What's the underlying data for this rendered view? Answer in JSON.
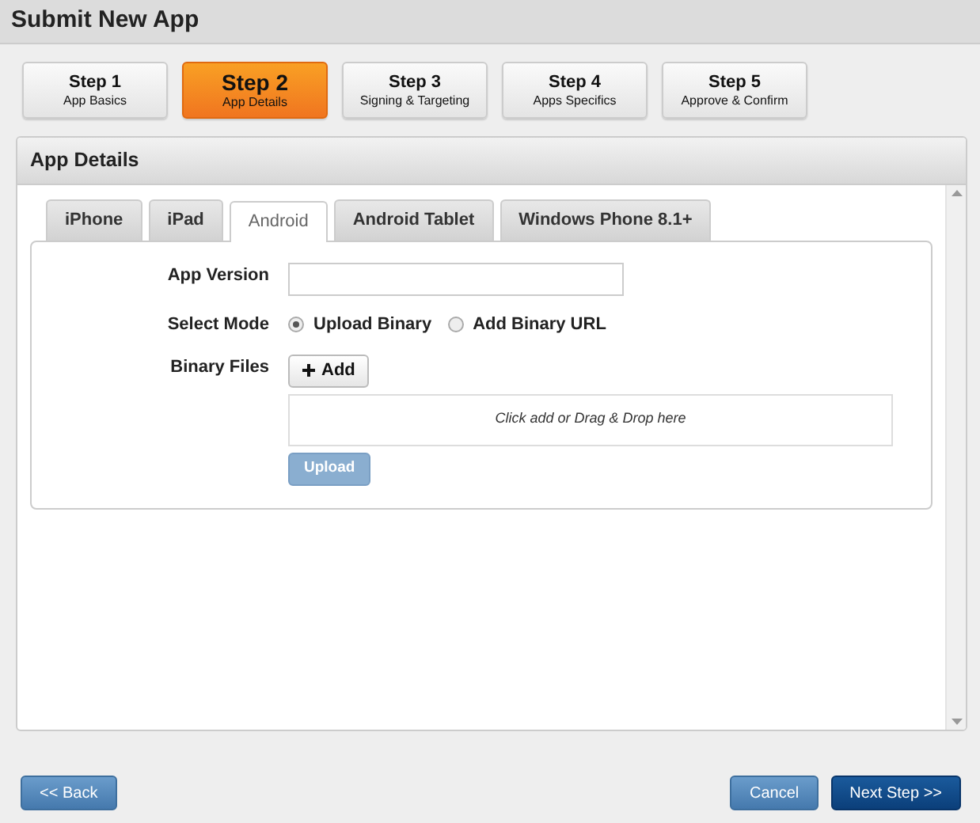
{
  "page_title": "Submit New App",
  "steps": [
    {
      "title": "Step 1",
      "subtitle": "App Basics",
      "selected": false
    },
    {
      "title": "Step 2",
      "subtitle": "App Details",
      "selected": true
    },
    {
      "title": "Step 3",
      "subtitle": "Signing & Targeting",
      "selected": false
    },
    {
      "title": "Step 4",
      "subtitle": "Apps Specifics",
      "selected": false
    },
    {
      "title": "Step 5",
      "subtitle": "Approve & Confirm",
      "selected": false
    }
  ],
  "panel_title": "App Details",
  "tabs": [
    {
      "label": "iPhone",
      "selected": false
    },
    {
      "label": "iPad",
      "selected": false
    },
    {
      "label": "Android",
      "selected": true
    },
    {
      "label": "Android Tablet",
      "selected": false
    },
    {
      "label": "Windows Phone 8.1+",
      "selected": false
    }
  ],
  "form": {
    "app_version_label": "App Version",
    "select_mode_label": "Select Mode",
    "modes": [
      {
        "label": "Upload Binary",
        "selected": true
      },
      {
        "label": "Add Binary URL",
        "selected": false
      }
    ],
    "binary_files_label": "Binary Files",
    "add_button": "Add",
    "drop_zone": "Click add or Drag & Drop here",
    "upload_button": {
      "label": "Upload",
      "disabled": true
    }
  },
  "footer": {
    "back": "<< Back",
    "cancel": "Cancel",
    "next": "Next Step >>"
  }
}
